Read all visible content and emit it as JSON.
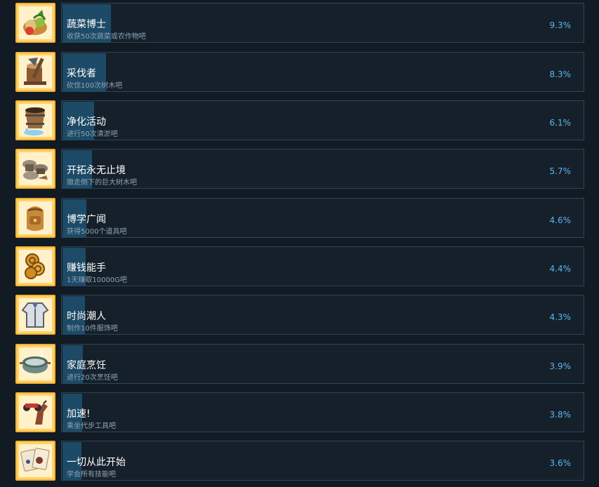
{
  "achievements": [
    {
      "title": "蔬菜博士",
      "desc": "收获50次蔬菜或农作物吧",
      "percent": "9.3%",
      "bar_fraction": 0.093,
      "icon": "vegetables-icon"
    },
    {
      "title": "采伐者",
      "desc": "砍伐100次树木吧",
      "percent": "8.3%",
      "bar_fraction": 0.083,
      "icon": "axe-log-icon"
    },
    {
      "title": "净化活动",
      "desc": "进行50次清淤吧",
      "percent": "6.1%",
      "bar_fraction": 0.061,
      "icon": "bucket-icon"
    },
    {
      "title": "开拓永无止境",
      "desc": "撤走倒下的巨大树木吧",
      "percent": "5.7%",
      "bar_fraction": 0.057,
      "icon": "stumps-icon"
    },
    {
      "title": "博学广闻",
      "desc": "获得5000个道具吧",
      "percent": "4.6%",
      "bar_fraction": 0.046,
      "icon": "backpack-icon"
    },
    {
      "title": "赚钱能手",
      "desc": "1天赚取10000G吧",
      "percent": "4.4%",
      "bar_fraction": 0.044,
      "icon": "coins-icon"
    },
    {
      "title": "时尚潮人",
      "desc": "制作10件服饰吧",
      "percent": "4.3%",
      "bar_fraction": 0.043,
      "icon": "jacket-icon"
    },
    {
      "title": "家庭烹饪",
      "desc": "进行20次烹饪吧",
      "percent": "3.9%",
      "bar_fraction": 0.039,
      "icon": "cooking-pot-icon"
    },
    {
      "title": "加速!",
      "desc": "乘坐代步工具吧",
      "percent": "3.8%",
      "bar_fraction": 0.038,
      "icon": "horse-motorbike-icon"
    },
    {
      "title": "一切从此开始",
      "desc": "学会所有技能吧",
      "percent": "3.6%",
      "bar_fraction": 0.036,
      "icon": "skill-cards-icon"
    }
  ]
}
